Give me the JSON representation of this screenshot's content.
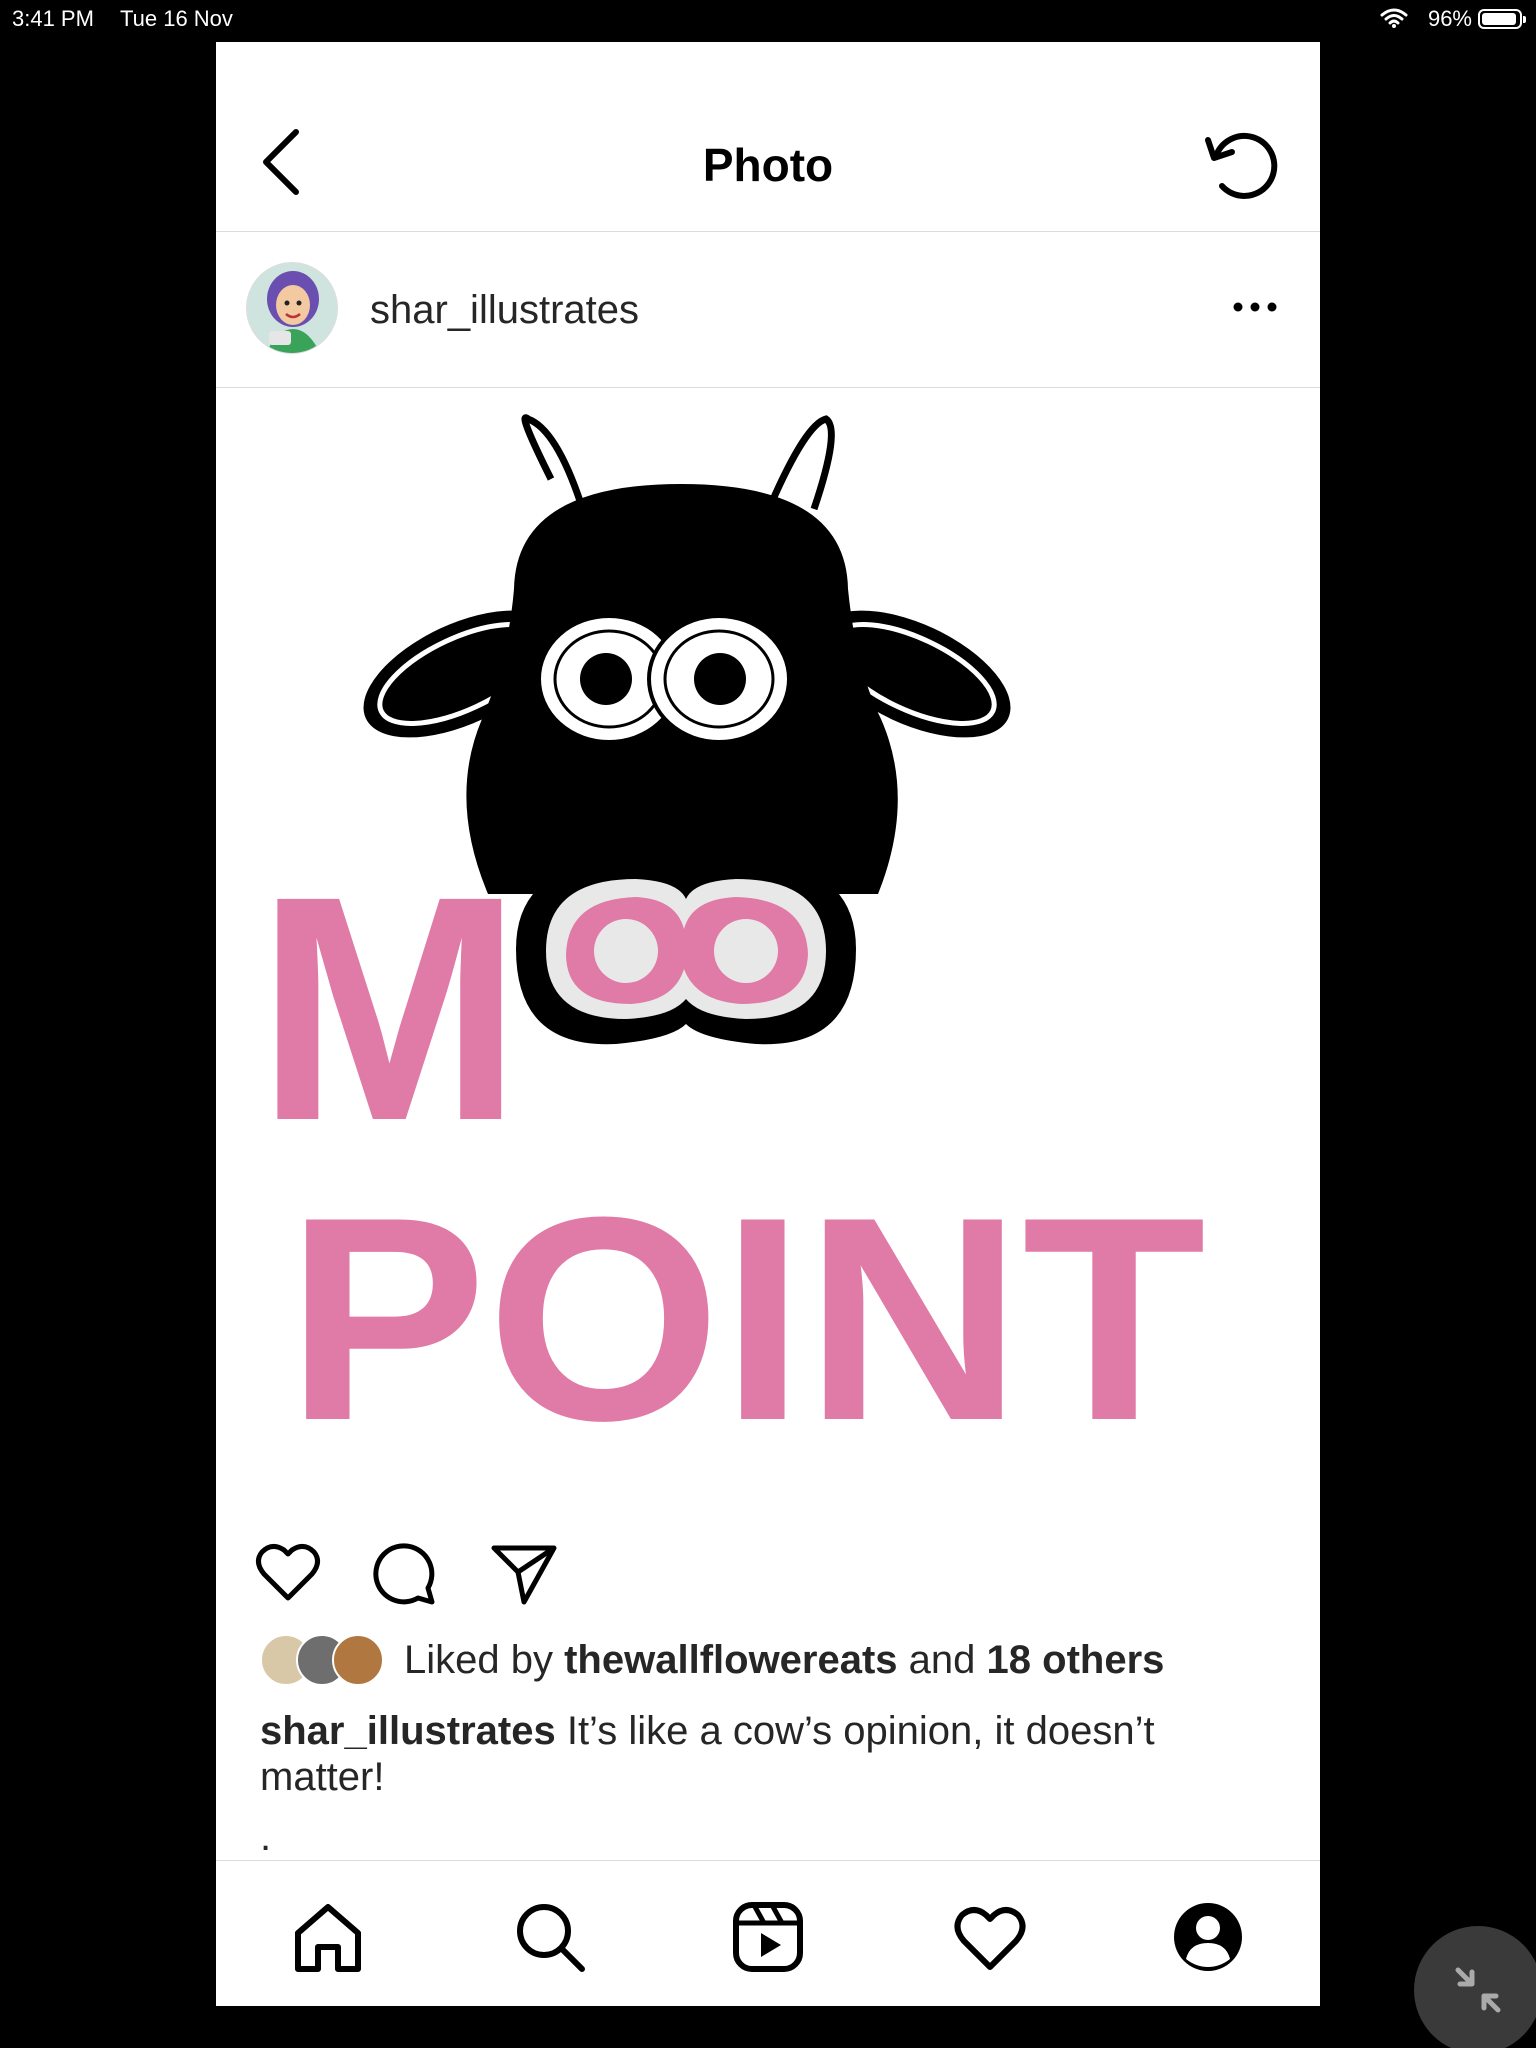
{
  "status_bar": {
    "time": "3:41 PM",
    "date": "Tue 16 Nov",
    "battery": "96%"
  },
  "nav": {
    "title": "Photo",
    "back_icon": "chevron-left-icon",
    "refresh_icon": "refresh-icon"
  },
  "post": {
    "username": "shar_illustrates",
    "more_icon": "more-horizontal-icon",
    "image_text": {
      "line1": "M",
      "line2": "POINT"
    },
    "colors": {
      "pink": "#e07aa6",
      "black": "#000000"
    },
    "liked_prefix": "Liked by",
    "liked_user": "thewallflowereats",
    "liked_and": "and",
    "liked_others": "18 others",
    "caption_user": "shar_illustrates",
    "caption_text": "It’s like a cow’s opinion, it doesn’t matter!",
    "caption_extra": "."
  },
  "actions": [
    "heart-icon",
    "comment-icon",
    "share-icon"
  ],
  "tabbar": [
    "home-icon",
    "search-icon",
    "reels-icon",
    "activity-heart-icon",
    "profile-icon"
  ]
}
